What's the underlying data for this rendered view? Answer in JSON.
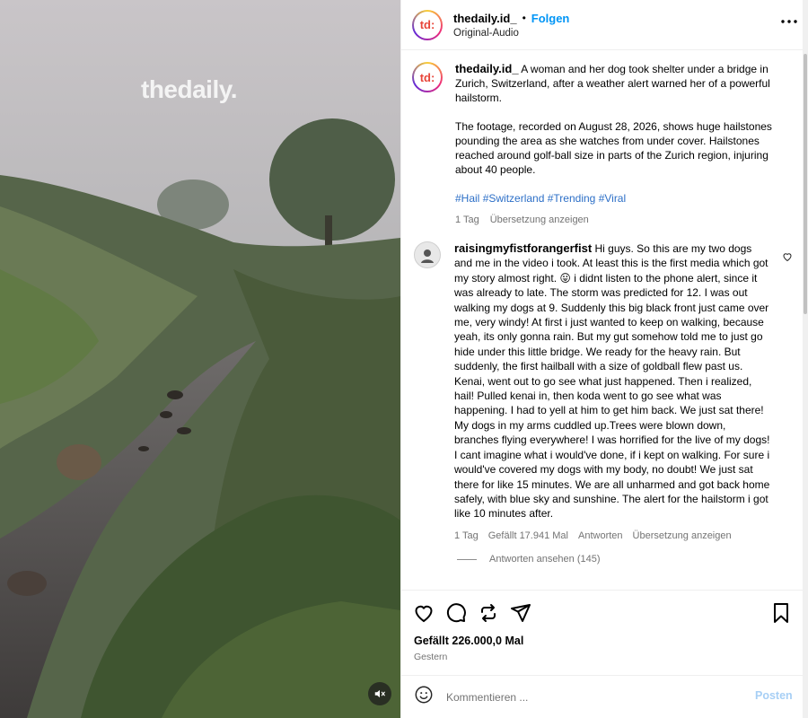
{
  "media": {
    "watermark": "thedaily.",
    "mute_icon": "speaker-muted-icon"
  },
  "header": {
    "avatar_text": "td:",
    "username": "thedaily.id_",
    "separator": "•",
    "follow_label": "Folgen",
    "audio_label": "Original-Audio",
    "more_icon": "more-options-icon"
  },
  "caption": {
    "avatar_text": "td:",
    "username": "thedaily.id_",
    "paragraph1": "A woman and her dog took shelter under a bridge in Zurich, Switzerland, after a weather alert warned her of a powerful hailstorm.",
    "paragraph2": "The footage, recorded on August 28, 2026, shows huge hailstones pounding the area as she watches from under cover. Hailstones reached around golf-ball size in parts of the Zurich region, injuring about 40 people.",
    "hashtags": [
      "#Hail",
      "#Switzerland",
      "#Trending",
      "#Viral"
    ],
    "time": "1 Tag",
    "translate_label": "Übersetzung anzeigen"
  },
  "comment": {
    "username": "raisingmyfistforangerfist",
    "text": "Hi guys. So this are my two dogs and me in the video i took. At least this is the first media which got my story almost right. 😛 i didnt listen to the phone alert, since it was already to late. The storm was predicted for 12. I was out walking my dogs at 9. Suddenly this big black front just came over me, very windy! At first i just wanted to keep on walking, because yeah, its only gonna rain. But my gut somehow told me to just go hide under this little bridge. We ready for the heavy rain. But suddenly, the first hailball with a size of goldball flew past us. Kenai, went out to go see what just happened. Then i realized, hail! Pulled kenai in, then koda went to go see what was happening. I had to yell at him to get him back. We just sat there! My dogs in my arms cuddled up.Trees were blown down, branches flying everywhere! I was horrified for the live of my dogs! I cant imagine what i would've done, if i kept on walking. For sure i would've covered my dogs with my body, no doubt! We just sat there for like 15 minutes. We are all unharmed and got back home safely, with blue sky and sunshine. The alert for the hailstorm i got like 10 minutes after.",
    "time": "1 Tag",
    "likes": "Gefällt 17.941 Mal",
    "reply_label": "Antworten",
    "translate_label": "Übersetzung anzeigen",
    "view_replies": "Antworten ansehen (145)"
  },
  "actions": {
    "like_icon": "heart-icon",
    "comment_icon": "comment-bubble-icon",
    "repost_icon": "repost-icon",
    "share_icon": "send-icon",
    "save_icon": "bookmark-icon"
  },
  "stats": {
    "likes": "Gefällt 226.000,0 Mal",
    "date": "Gestern"
  },
  "composer": {
    "placeholder": "Kommentieren ...",
    "post_label": "Posten",
    "emoji_icon": "emoji-icon"
  },
  "colors": {
    "accent": "#0095f6",
    "hashtag": "#2c6fc7",
    "muted": "#737373",
    "post_disabled": "#a7cff5"
  }
}
